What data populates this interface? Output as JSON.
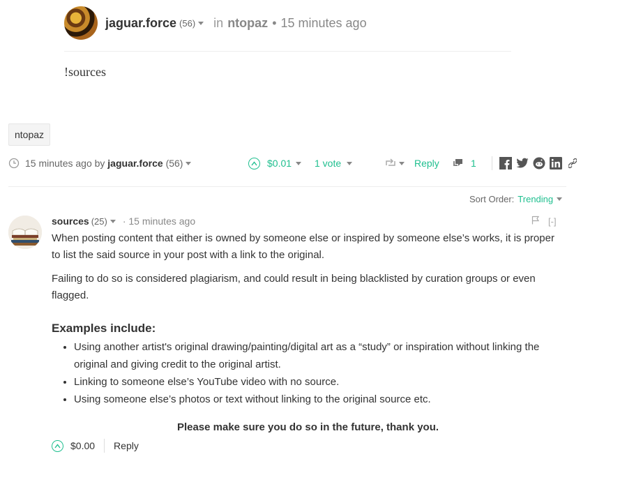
{
  "post": {
    "author": "jaguar.force",
    "reputation": "(56)",
    "in_word": "in",
    "community": "ntopaz",
    "dot": "•",
    "time": "15 minutes ago",
    "body": "!sources"
  },
  "tag": "ntopaz",
  "footer": {
    "time_by": "15 minutes ago by",
    "author": "jaguar.force",
    "reputation": "(56)",
    "payout": "$0.01",
    "votes": "1 vote",
    "reply": "Reply",
    "comment_count": "1",
    "share_icons": [
      "facebook-icon",
      "twitter-icon",
      "reddit-icon",
      "linkedin-icon",
      "link-icon"
    ]
  },
  "sort": {
    "label": "Sort Order:",
    "value": "Trending"
  },
  "comment": {
    "author": "sources",
    "reputation": "(25)",
    "time": "· 15 minutes ago",
    "collapse": "[-]",
    "paragraph1": "When posting content that either is owned by someone else or inspired by someone else’s works, it is proper to list the said source in your post with a link to the original.",
    "paragraph2": "Failing to do so is considered plagiarism, and could result in being blacklisted by curation groups or even flagged.",
    "examples_heading": "Examples include:",
    "examples": [
      "Using another artist's original drawing/painting/digital art as a “study” or inspiration without linking the original and giving credit to the original artist.",
      "Linking to someone else’s YouTube video with no source.",
      "Using someone else’s photos or text without linking to the original source etc."
    ],
    "closing": "Please make sure you do so in the future, thank you.",
    "payout": "$0.00",
    "reply": "Reply"
  },
  "colors": {
    "accent": "#1fbf8f",
    "text": "#333333",
    "muted": "#888888"
  }
}
